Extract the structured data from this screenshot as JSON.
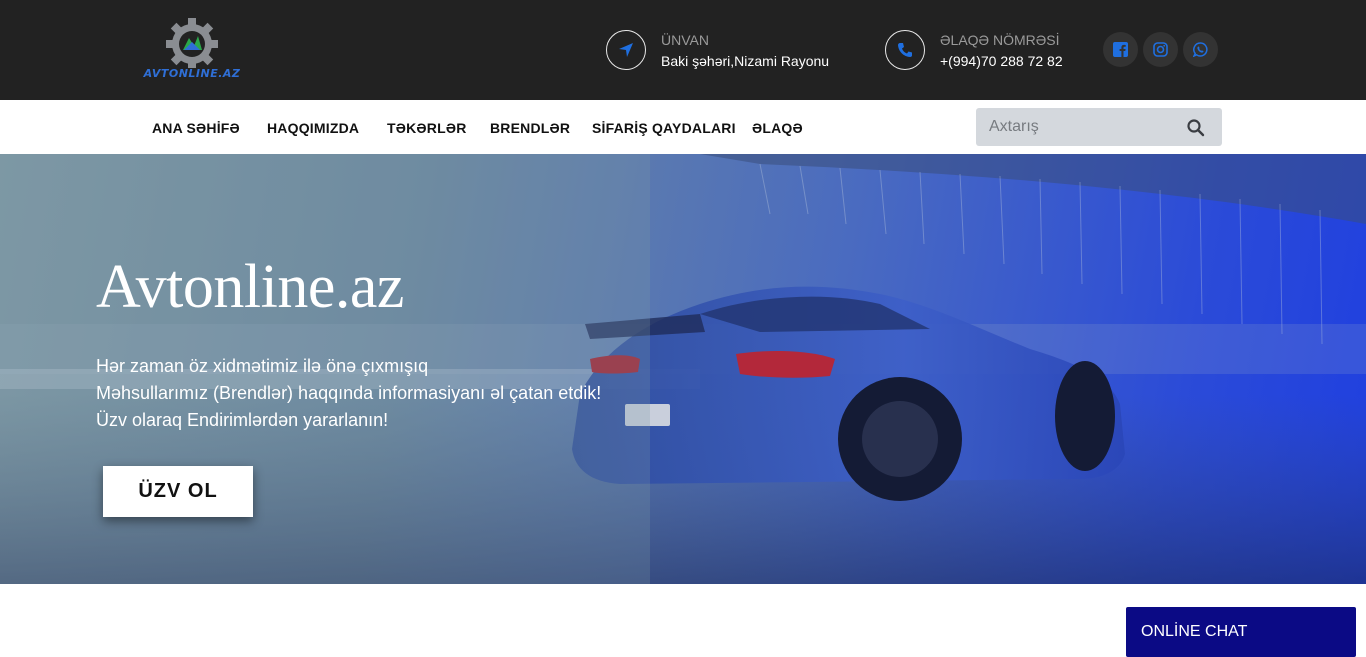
{
  "header": {
    "logo_text": "AVTONLINE.AZ",
    "address": {
      "label": "ÜNVAN",
      "value": "Baki şəhəri,Nizami Rayonu",
      "icon": "location-arrow-icon"
    },
    "phone": {
      "label": "ƏLAQƏ NÖMRƏSİ",
      "value": "+(994)70 288 72 82",
      "icon": "phone-icon"
    },
    "social": [
      {
        "name": "facebook",
        "icon": "facebook-icon"
      },
      {
        "name": "instagram",
        "icon": "instagram-icon"
      },
      {
        "name": "whatsapp",
        "icon": "whatsapp-icon"
      }
    ],
    "accent_color": "#1f6fe0"
  },
  "nav": {
    "items": [
      {
        "label": "ANA SƏHİFƏ"
      },
      {
        "label": "HAQQIMIZDA"
      },
      {
        "label": "TƏKƏRLƏR"
      },
      {
        "label": "BRENDLƏR"
      },
      {
        "label": "SİFARİŞ QAYDALARI"
      },
      {
        "label": "ƏLAQƏ"
      }
    ],
    "search": {
      "placeholder": "Axtarış",
      "icon": "search-icon"
    }
  },
  "hero": {
    "title": "Avtonline.az",
    "lines": [
      "Hər zaman öz xidmətimiz ilə önə çıxmışıq",
      "Məhsullarımız (Brendlər) haqqında informasiyanı əl çatan etdik!",
      "Üzv olaraq Endirimlərdən yararlanın!"
    ],
    "cta_label": "ÜZV OL"
  },
  "chat": {
    "label": "ONLİNE CHAT",
    "color": "#0b0a85"
  }
}
